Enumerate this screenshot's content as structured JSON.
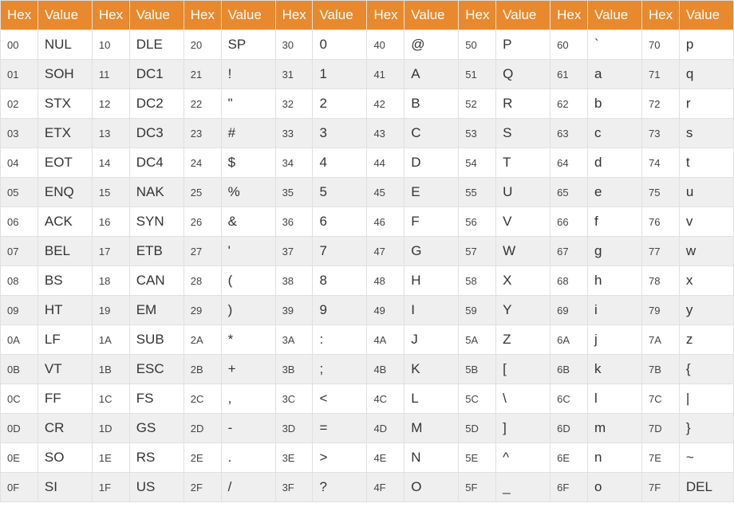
{
  "headers": {
    "hex_label": "Hex",
    "value_label": "Value"
  },
  "column_count": 8,
  "rows_per_column": 16,
  "data": [
    [
      {
        "hex": "00",
        "value": "NUL"
      },
      {
        "hex": "01",
        "value": "SOH"
      },
      {
        "hex": "02",
        "value": "STX"
      },
      {
        "hex": "03",
        "value": "ETX"
      },
      {
        "hex": "04",
        "value": "EOT"
      },
      {
        "hex": "05",
        "value": "ENQ"
      },
      {
        "hex": "06",
        "value": "ACK"
      },
      {
        "hex": "07",
        "value": "BEL"
      },
      {
        "hex": "08",
        "value": "BS"
      },
      {
        "hex": "09",
        "value": "HT"
      },
      {
        "hex": "0A",
        "value": "LF"
      },
      {
        "hex": "0B",
        "value": "VT"
      },
      {
        "hex": "0C",
        "value": "FF"
      },
      {
        "hex": "0D",
        "value": "CR"
      },
      {
        "hex": "0E",
        "value": "SO"
      },
      {
        "hex": "0F",
        "value": "SI"
      }
    ],
    [
      {
        "hex": "10",
        "value": "DLE"
      },
      {
        "hex": "11",
        "value": "DC1"
      },
      {
        "hex": "12",
        "value": "DC2"
      },
      {
        "hex": "13",
        "value": "DC3"
      },
      {
        "hex": "14",
        "value": "DC4"
      },
      {
        "hex": "15",
        "value": "NAK"
      },
      {
        "hex": "16",
        "value": "SYN"
      },
      {
        "hex": "17",
        "value": "ETB"
      },
      {
        "hex": "18",
        "value": "CAN"
      },
      {
        "hex": "19",
        "value": "EM"
      },
      {
        "hex": "1A",
        "value": "SUB"
      },
      {
        "hex": "1B",
        "value": "ESC"
      },
      {
        "hex": "1C",
        "value": "FS"
      },
      {
        "hex": "1D",
        "value": "GS"
      },
      {
        "hex": "1E",
        "value": "RS"
      },
      {
        "hex": "1F",
        "value": "US"
      }
    ],
    [
      {
        "hex": "20",
        "value": "SP"
      },
      {
        "hex": "21",
        "value": "!"
      },
      {
        "hex": "22",
        "value": "\""
      },
      {
        "hex": "23",
        "value": "#"
      },
      {
        "hex": "24",
        "value": "$"
      },
      {
        "hex": "25",
        "value": "%"
      },
      {
        "hex": "26",
        "value": "&"
      },
      {
        "hex": "27",
        "value": "'"
      },
      {
        "hex": "28",
        "value": "("
      },
      {
        "hex": "29",
        "value": ")"
      },
      {
        "hex": "2A",
        "value": "*"
      },
      {
        "hex": "2B",
        "value": "+"
      },
      {
        "hex": "2C",
        "value": ","
      },
      {
        "hex": "2D",
        "value": "-"
      },
      {
        "hex": "2E",
        "value": "."
      },
      {
        "hex": "2F",
        "value": "/"
      }
    ],
    [
      {
        "hex": "30",
        "value": "0"
      },
      {
        "hex": "31",
        "value": "1"
      },
      {
        "hex": "32",
        "value": "2"
      },
      {
        "hex": "33",
        "value": "3"
      },
      {
        "hex": "34",
        "value": "4"
      },
      {
        "hex": "35",
        "value": "5"
      },
      {
        "hex": "36",
        "value": "6"
      },
      {
        "hex": "37",
        "value": "7"
      },
      {
        "hex": "38",
        "value": "8"
      },
      {
        "hex": "39",
        "value": "9"
      },
      {
        "hex": "3A",
        "value": ":"
      },
      {
        "hex": "3B",
        "value": ";"
      },
      {
        "hex": "3C",
        "value": "<"
      },
      {
        "hex": "3D",
        "value": "="
      },
      {
        "hex": "3E",
        "value": ">"
      },
      {
        "hex": "3F",
        "value": "?"
      }
    ],
    [
      {
        "hex": "40",
        "value": "@"
      },
      {
        "hex": "41",
        "value": "A"
      },
      {
        "hex": "42",
        "value": "B"
      },
      {
        "hex": "43",
        "value": "C"
      },
      {
        "hex": "44",
        "value": "D"
      },
      {
        "hex": "45",
        "value": "E"
      },
      {
        "hex": "46",
        "value": "F"
      },
      {
        "hex": "47",
        "value": "G"
      },
      {
        "hex": "48",
        "value": "H"
      },
      {
        "hex": "49",
        "value": "I"
      },
      {
        "hex": "4A",
        "value": "J"
      },
      {
        "hex": "4B",
        "value": "K"
      },
      {
        "hex": "4C",
        "value": "L"
      },
      {
        "hex": "4D",
        "value": "M"
      },
      {
        "hex": "4E",
        "value": "N"
      },
      {
        "hex": "4F",
        "value": "O"
      }
    ],
    [
      {
        "hex": "50",
        "value": "P"
      },
      {
        "hex": "51",
        "value": "Q"
      },
      {
        "hex": "52",
        "value": "R"
      },
      {
        "hex": "53",
        "value": "S"
      },
      {
        "hex": "54",
        "value": "T"
      },
      {
        "hex": "55",
        "value": "U"
      },
      {
        "hex": "56",
        "value": "V"
      },
      {
        "hex": "57",
        "value": "W"
      },
      {
        "hex": "58",
        "value": "X"
      },
      {
        "hex": "59",
        "value": "Y"
      },
      {
        "hex": "5A",
        "value": "Z"
      },
      {
        "hex": "5B",
        "value": "["
      },
      {
        "hex": "5C",
        "value": "\\"
      },
      {
        "hex": "5D",
        "value": "]"
      },
      {
        "hex": "5E",
        "value": "^"
      },
      {
        "hex": "5F",
        "value": "_"
      }
    ],
    [
      {
        "hex": "60",
        "value": "`"
      },
      {
        "hex": "61",
        "value": "a"
      },
      {
        "hex": "62",
        "value": "b"
      },
      {
        "hex": "63",
        "value": "c"
      },
      {
        "hex": "64",
        "value": "d"
      },
      {
        "hex": "65",
        "value": "e"
      },
      {
        "hex": "66",
        "value": "f"
      },
      {
        "hex": "67",
        "value": "g"
      },
      {
        "hex": "68",
        "value": "h"
      },
      {
        "hex": "69",
        "value": "i"
      },
      {
        "hex": "6A",
        "value": "j"
      },
      {
        "hex": "6B",
        "value": "k"
      },
      {
        "hex": "6C",
        "value": "l"
      },
      {
        "hex": "6D",
        "value": "m"
      },
      {
        "hex": "6E",
        "value": "n"
      },
      {
        "hex": "6F",
        "value": "o"
      }
    ],
    [
      {
        "hex": "70",
        "value": "p"
      },
      {
        "hex": "71",
        "value": "q"
      },
      {
        "hex": "72",
        "value": "r"
      },
      {
        "hex": "73",
        "value": "s"
      },
      {
        "hex": "74",
        "value": "t"
      },
      {
        "hex": "75",
        "value": "u"
      },
      {
        "hex": "76",
        "value": "v"
      },
      {
        "hex": "77",
        "value": "w"
      },
      {
        "hex": "78",
        "value": "x"
      },
      {
        "hex": "79",
        "value": "y"
      },
      {
        "hex": "7A",
        "value": "z"
      },
      {
        "hex": "7B",
        "value": "{"
      },
      {
        "hex": "7C",
        "value": "|"
      },
      {
        "hex": "7D",
        "value": "}"
      },
      {
        "hex": "7E",
        "value": "~"
      },
      {
        "hex": "7F",
        "value": "DEL"
      }
    ]
  ]
}
